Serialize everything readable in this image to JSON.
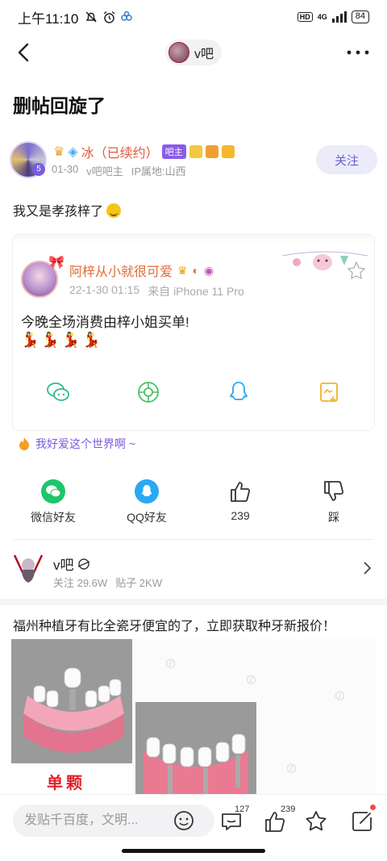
{
  "status_bar": {
    "time": "上午11:10",
    "network": "4G",
    "battery": "84"
  },
  "header": {
    "forum_name": "v吧"
  },
  "post": {
    "title": "删帖回旋了",
    "author": {
      "name": "冰（已续约）",
      "level": "5",
      "owner_badge": "吧主",
      "date": "01-30",
      "role": "v吧吧主",
      "ip_location": "IP属地:山西"
    },
    "follow_label": "关注",
    "body": "我又是孝孩梓了"
  },
  "quote": {
    "author_name": "阿梓从小就很可爱",
    "time": "22-1-30 01:15",
    "source": "来自 iPhone 11 Pro",
    "text": "今晚全场消费由梓小姐买单!",
    "emojis": "💃💃💃💃"
  },
  "signature": "我好爱这个世界啊 ~",
  "share": {
    "wechat": "微信好友",
    "qq": "QQ好友",
    "like_count": "239",
    "dislike": "踩"
  },
  "forum_card": {
    "name": "v吧",
    "follow_count": "关注 29.6W",
    "post_count": "贴子 2KW"
  },
  "ad": {
    "title": "福州种植牙有比全瓷牙便宜的了，立即获取种牙新报价！",
    "label": "单颗"
  },
  "bottom_bar": {
    "comment_placeholder": "发贴千百度，文明...",
    "comment_count": "127",
    "like_count": "239"
  },
  "colors": {
    "accent": "#6b5fd0",
    "author_name": "#e05a3a",
    "wechat": "#1ec56b",
    "qq": "#29a8f3",
    "ad_label": "#e0202a"
  }
}
